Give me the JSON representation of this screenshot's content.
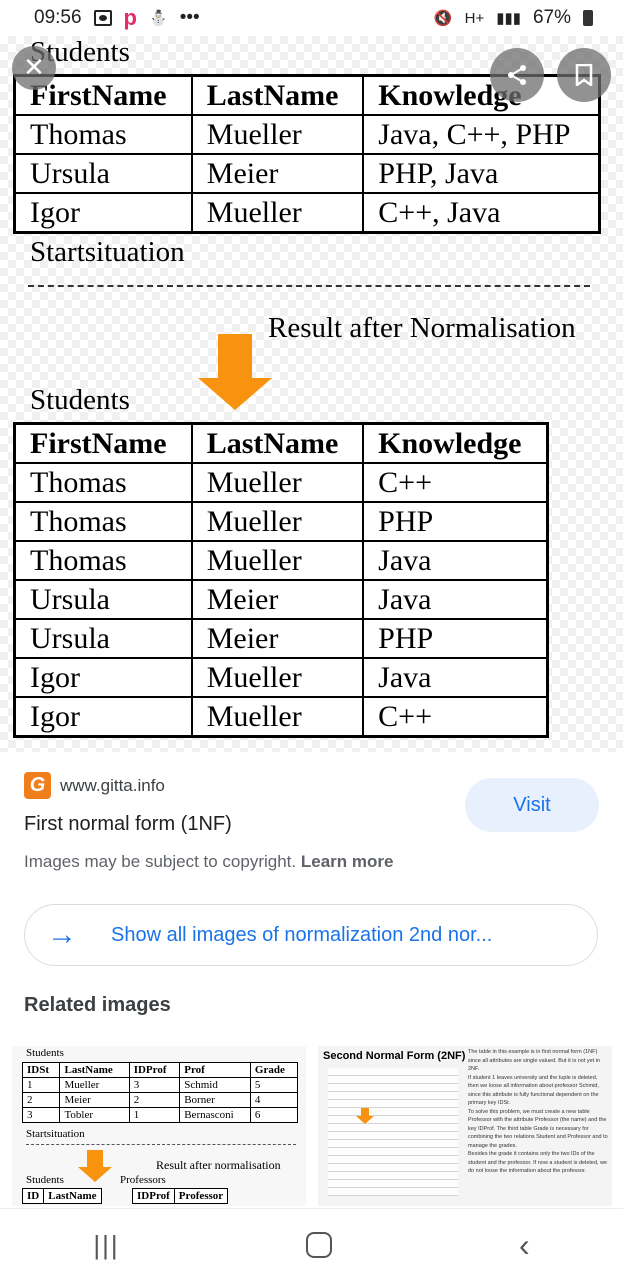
{
  "status_bar": {
    "time": "09:56",
    "app_letter": "p",
    "more": "•••",
    "net": "H+",
    "battery": "67%"
  },
  "figure": {
    "top_caption": "Students",
    "headers": [
      "FirstName",
      "LastName",
      "Knowledge"
    ],
    "rows": [
      [
        "Thomas",
        "Mueller",
        "Java, C++, PHP"
      ],
      [
        "Ursula",
        "Meier",
        "PHP, Java"
      ],
      [
        "Igor",
        "Mueller",
        "C++, Java"
      ]
    ],
    "start_label": "Startsituation",
    "result_label": "Result after Normalisation",
    "bottom_caption": "Students",
    "norm_rows": [
      [
        "Thomas",
        "Mueller",
        "C++"
      ],
      [
        "Thomas",
        "Mueller",
        "PHP"
      ],
      [
        "Thomas",
        "Mueller",
        "Java"
      ],
      [
        "Ursula",
        "Meier",
        "Java"
      ],
      [
        "Ursula",
        "Meier",
        "PHP"
      ],
      [
        "Igor",
        "Mueller",
        "Java"
      ],
      [
        "Igor",
        "Mueller",
        "C++"
      ]
    ]
  },
  "overlay": {
    "close_icon": "✕",
    "share_icon": "share",
    "save_icon": "bookmark"
  },
  "source": {
    "logo_letter": "G",
    "domain": "www.gitta.info",
    "title": "First normal form (1NF)",
    "visit_label": "Visit"
  },
  "copyright": {
    "text": "Images may be subject to copyright.",
    "link": "Learn more"
  },
  "show_all": {
    "label": "Show all images of normalization 2nd nor..."
  },
  "related": {
    "heading": "Related images",
    "thumb1": {
      "caption": "Students",
      "headers": [
        "IDSt",
        "LastName",
        "IDProf",
        "Prof",
        "Grade"
      ],
      "rows": [
        [
          "1",
          "Mueller",
          "3",
          "Schmid",
          "5"
        ],
        [
          "2",
          "Meier",
          "2",
          "Borner",
          "4"
        ],
        [
          "3",
          "Tobler",
          "1",
          "Bernasconi",
          "6"
        ]
      ],
      "start": "Startsituation",
      "result": "Result after normalisation",
      "students": "Students",
      "professors": "Professors",
      "h2": [
        "ID",
        "LastName"
      ],
      "h3": [
        "IDProf",
        "Professor"
      ]
    },
    "thumb2": {
      "title": "Second Normal Form (2NF)",
      "notes": [
        "The table in this example is in first normal form (1NF) since all attributes are single valued. But it is not yet in 2NF.",
        "If student 1 leaves university and the tuple is deleted, then we loose all information about professor Schmid, since this attribute is fully functional dependent on the primary key IDSt.",
        "To solve this problem, we must create a new table Professor with the attribute Professor (the name) and the key IDProf. The third table Grade is necessary for combining the two relations Student and Professor and to manage the grades.",
        "Besides the grade it contains only the two IDs of the student and the professor. If now a student is deleted, we do not loose the information about the professor."
      ]
    }
  },
  "nav": {
    "recent": "|||",
    "back": "‹"
  }
}
